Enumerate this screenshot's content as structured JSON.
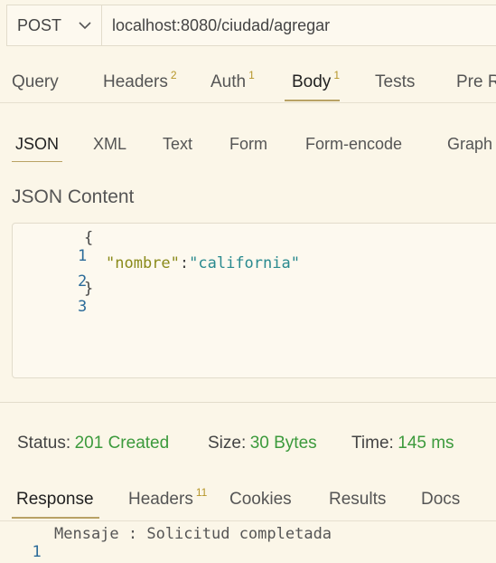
{
  "request": {
    "method": "POST",
    "url": "localhost:8080/ciudad/agregar"
  },
  "tabs": [
    {
      "label": "Query",
      "count": ""
    },
    {
      "label": "Headers",
      "count": "2"
    },
    {
      "label": "Auth",
      "count": "1"
    },
    {
      "label": "Body",
      "count": "1"
    },
    {
      "label": "Tests",
      "count": ""
    },
    {
      "label": "Pre R",
      "count": ""
    }
  ],
  "active_tab": "Body",
  "body_types": [
    "JSON",
    "XML",
    "Text",
    "Form",
    "Form-encode",
    "Graph"
  ],
  "active_body_type": "JSON",
  "editor": {
    "title": "JSON Content",
    "lines": [
      {
        "num": "1",
        "text": "{"
      },
      {
        "num": "2",
        "key": "\"nombre\"",
        "colon": ":",
        "value": "\"california\""
      },
      {
        "num": "3",
        "text": "}"
      }
    ]
  },
  "status": {
    "status_label": "Status:",
    "status_value": "201 Created",
    "size_label": "Size:",
    "size_value": "30 Bytes",
    "time_label": "Time:",
    "time_value": "145 ms"
  },
  "response_tabs": [
    {
      "label": "Response",
      "count": ""
    },
    {
      "label": "Headers",
      "count": "11"
    },
    {
      "label": "Cookies",
      "count": ""
    },
    {
      "label": "Results",
      "count": ""
    },
    {
      "label": "Docs",
      "count": ""
    }
  ],
  "active_response_tab": "Response",
  "response": {
    "lines": [
      {
        "num": "1",
        "text": "Mensaje : Solicitud completada"
      }
    ]
  },
  "colors": {
    "background": "#fbf6e8",
    "accent": "#b9a265",
    "success": "#3c9a3c",
    "json_key": "#8a8a1a",
    "json_string": "#2a8a8f"
  }
}
